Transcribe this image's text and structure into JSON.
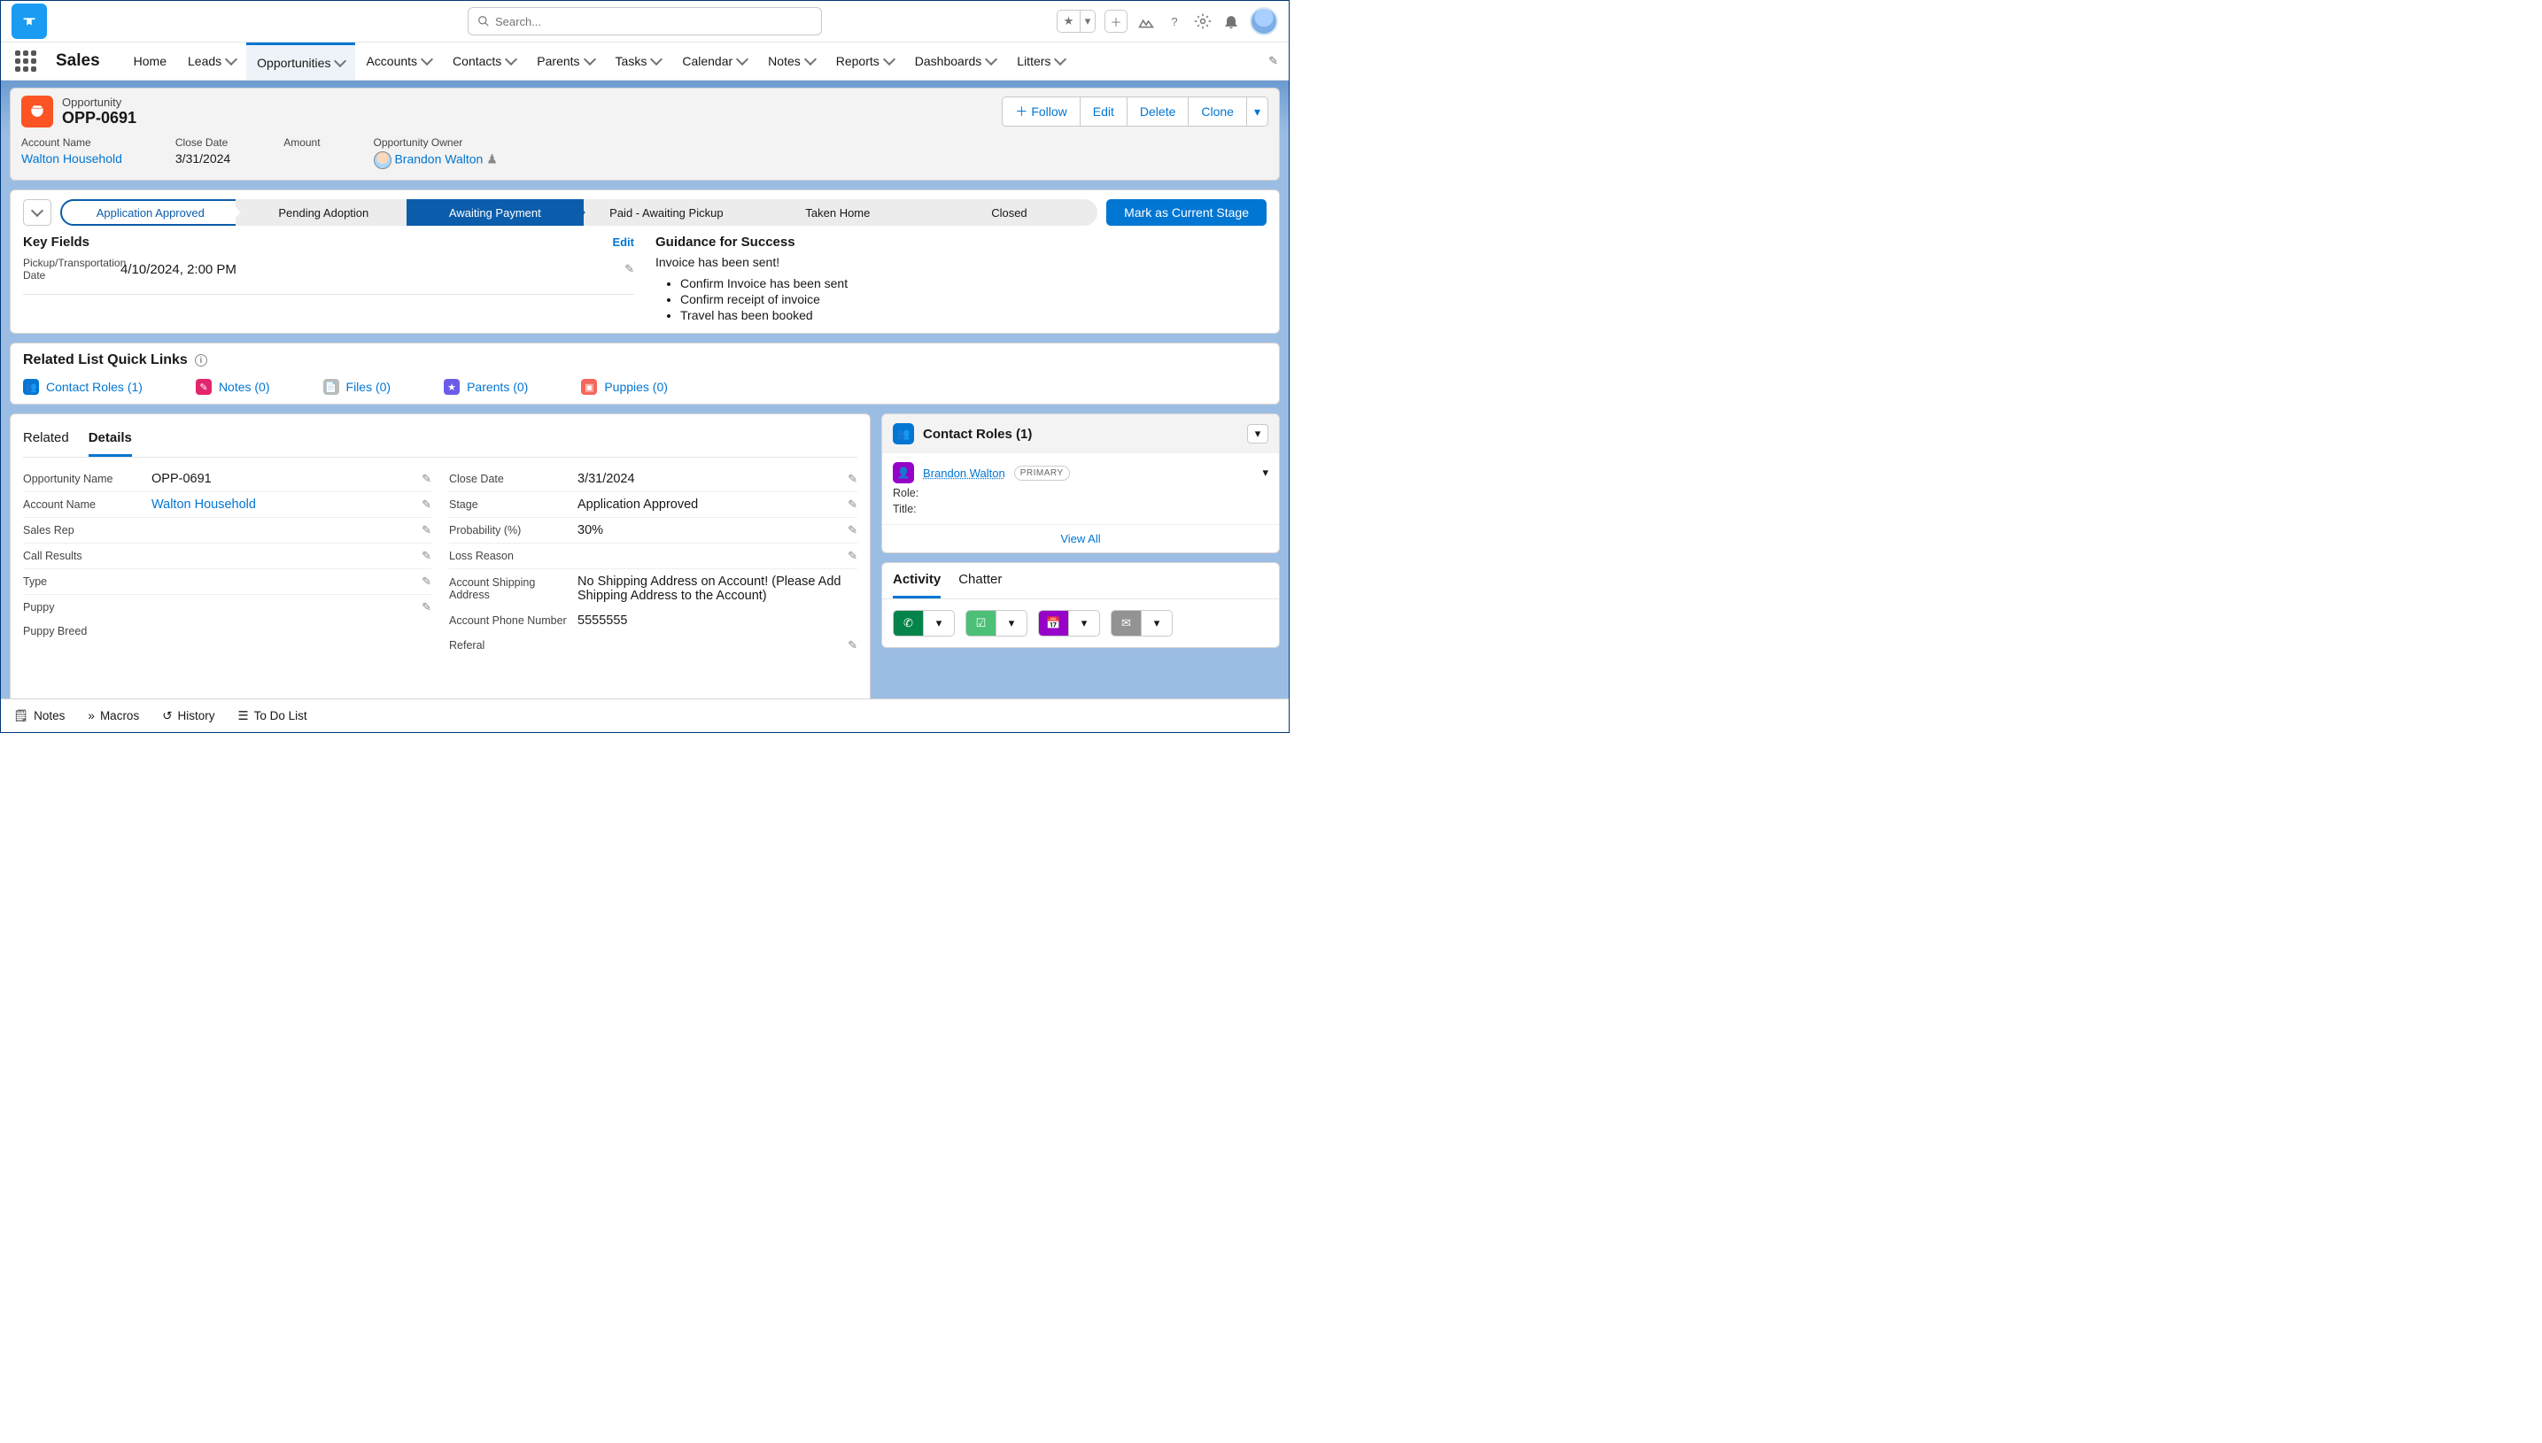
{
  "search": {
    "placeholder": "Search..."
  },
  "app": {
    "name": "Sales"
  },
  "nav": {
    "items": [
      "Home",
      "Leads",
      "Opportunities",
      "Accounts",
      "Contacts",
      "Parents",
      "Tasks",
      "Calendar",
      "Notes",
      "Reports",
      "Dashboards",
      "Litters"
    ],
    "active_index": 2
  },
  "record": {
    "object_label": "Opportunity",
    "name": "OPP-0691",
    "actions": {
      "follow": "Follow",
      "edit": "Edit",
      "delete": "Delete",
      "clone": "Clone"
    },
    "highlights": {
      "account_name": {
        "label": "Account Name",
        "value": "Walton Household"
      },
      "close_date": {
        "label": "Close Date",
        "value": "3/31/2024"
      },
      "amount": {
        "label": "Amount",
        "value": ""
      },
      "owner": {
        "label": "Opportunity Owner",
        "value": "Brandon Walton"
      }
    }
  },
  "path": {
    "steps": [
      "Application Approved",
      "Pending Adoption",
      "Awaiting Payment",
      "Paid - Awaiting Pickup",
      "Taken Home",
      "Closed"
    ],
    "current_index": 2,
    "mark_button": "Mark as Current Stage",
    "key_fields": {
      "title": "Key Fields",
      "edit": "Edit",
      "fields": [
        {
          "label": "Pickup/Transportation Date",
          "value": "4/10/2024, 2:00 PM"
        }
      ]
    },
    "guidance": {
      "title": "Guidance for Success",
      "lead": "Invoice has been sent!",
      "bullets": [
        "Confirm Invoice has been sent",
        "Confirm receipt of invoice",
        "Travel has been booked"
      ]
    }
  },
  "quick_links": {
    "title": "Related List Quick Links",
    "items": [
      {
        "label": "Contact Roles (1)",
        "color": "#0176d3"
      },
      {
        "label": "Notes (0)",
        "color": "#e2256d"
      },
      {
        "label": "Files (0)",
        "color": "#939393"
      },
      {
        "label": "Parents (0)",
        "color": "#6b5ce7"
      },
      {
        "label": "Puppies (0)",
        "color": "#f5675b"
      }
    ]
  },
  "detail_tabs": {
    "related": "Related",
    "details": "Details",
    "active": "details"
  },
  "details": {
    "left": [
      {
        "label": "Opportunity Name",
        "value": "OPP-0691"
      },
      {
        "label": "Account Name",
        "value": "Walton Household",
        "link": true
      },
      {
        "label": "Sales Rep",
        "value": ""
      },
      {
        "label": "Call Results",
        "value": ""
      },
      {
        "label": "Type",
        "value": ""
      },
      {
        "label": "Puppy",
        "value": ""
      },
      {
        "label": "Puppy Breed",
        "value": ""
      }
    ],
    "right": [
      {
        "label": "Close Date",
        "value": "3/31/2024"
      },
      {
        "label": "Stage",
        "value": "Application Approved"
      },
      {
        "label": "Probability (%)",
        "value": "30%"
      },
      {
        "label": "Loss Reason",
        "value": ""
      },
      {
        "label": "Account Shipping Address",
        "value": "No Shipping Address on Account! (Please Add Shipping Address to the Account)"
      },
      {
        "label": "Account Phone Number",
        "value": "5555555"
      },
      {
        "label": "Referal",
        "value": ""
      }
    ]
  },
  "contact_roles": {
    "title": "Contact Roles (1)",
    "person": "Brandon Walton",
    "badge": "PRIMARY",
    "role_label": "Role:",
    "title_label": "Title:",
    "view_all": "View All"
  },
  "activity": {
    "tabs": {
      "activity": "Activity",
      "chatter": "Chatter"
    }
  },
  "utility_bar": {
    "notes": "Notes",
    "macros": "Macros",
    "history": "History",
    "todo": "To Do List"
  }
}
